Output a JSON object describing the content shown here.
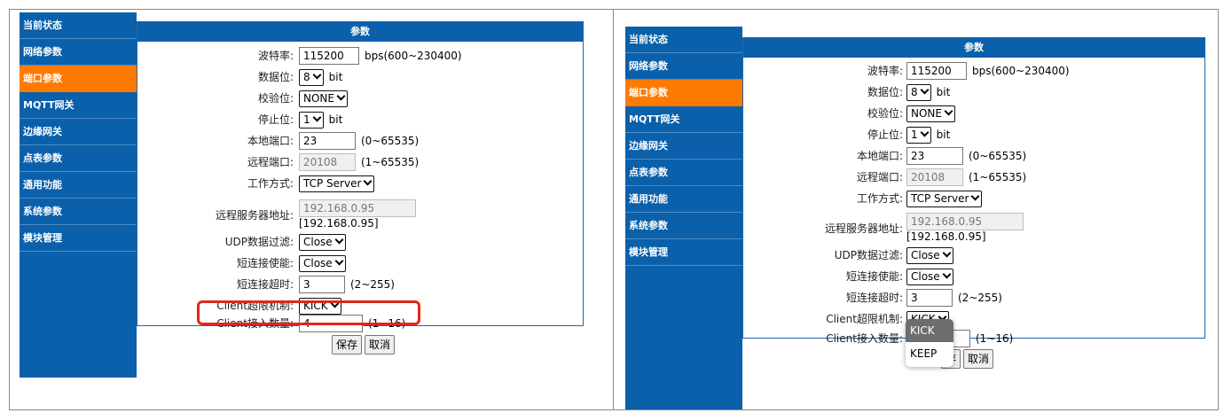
{
  "sidebar": {
    "items": [
      {
        "label": "当前状态"
      },
      {
        "label": "网络参数"
      },
      {
        "label": "端口参数",
        "active": true
      },
      {
        "label": "MQTT网关"
      },
      {
        "label": "边缘网关"
      },
      {
        "label": "点表参数"
      },
      {
        "label": "通用功能"
      },
      {
        "label": "系统参数"
      },
      {
        "label": "模块管理"
      }
    ]
  },
  "form": {
    "title": "参数",
    "baud_rate": {
      "label": "波特率:",
      "value": "115200",
      "hint": "bps(600~230400)"
    },
    "data_bits": {
      "label": "数据位:",
      "value": "8",
      "unit": "bit"
    },
    "parity": {
      "label": "校验位:",
      "value": "NONE"
    },
    "stop_bits": {
      "label": "停止位:",
      "value": "1",
      "unit": "bit"
    },
    "local_port": {
      "label": "本地端口:",
      "value": "23",
      "hint": "(0~65535)"
    },
    "remote_port": {
      "label": "远程端口:",
      "value": "20108",
      "hint": "(1~65535)"
    },
    "work_mode": {
      "label": "工作方式:",
      "value": "TCP Server"
    },
    "remote_server": {
      "label": "远程服务器地址:",
      "value": "192.168.0.95",
      "note": "[192.168.0.95]"
    },
    "udp_filter": {
      "label": "UDP数据过滤:",
      "value": "Close"
    },
    "short_conn_enable": {
      "label": "短连接使能:",
      "value": "Close"
    },
    "short_conn_timeout": {
      "label": "短连接超时:",
      "value": "3",
      "hint": "(2~255)"
    },
    "client_limit_mode": {
      "label": "Client超限机制:",
      "value": "KICK"
    },
    "client_count": {
      "label": "Client接入数量:",
      "value": "4",
      "hint": "(1~16)"
    },
    "save_label": "保存",
    "cancel_label": "取消",
    "save_partial_label": "存"
  },
  "dropdown": {
    "options": [
      "KICK",
      "KEEP"
    ],
    "selected": "KICK"
  },
  "colors": {
    "sidebar": "#0a60aa",
    "active": "#ff7a00",
    "highlight": "#e0271d"
  }
}
